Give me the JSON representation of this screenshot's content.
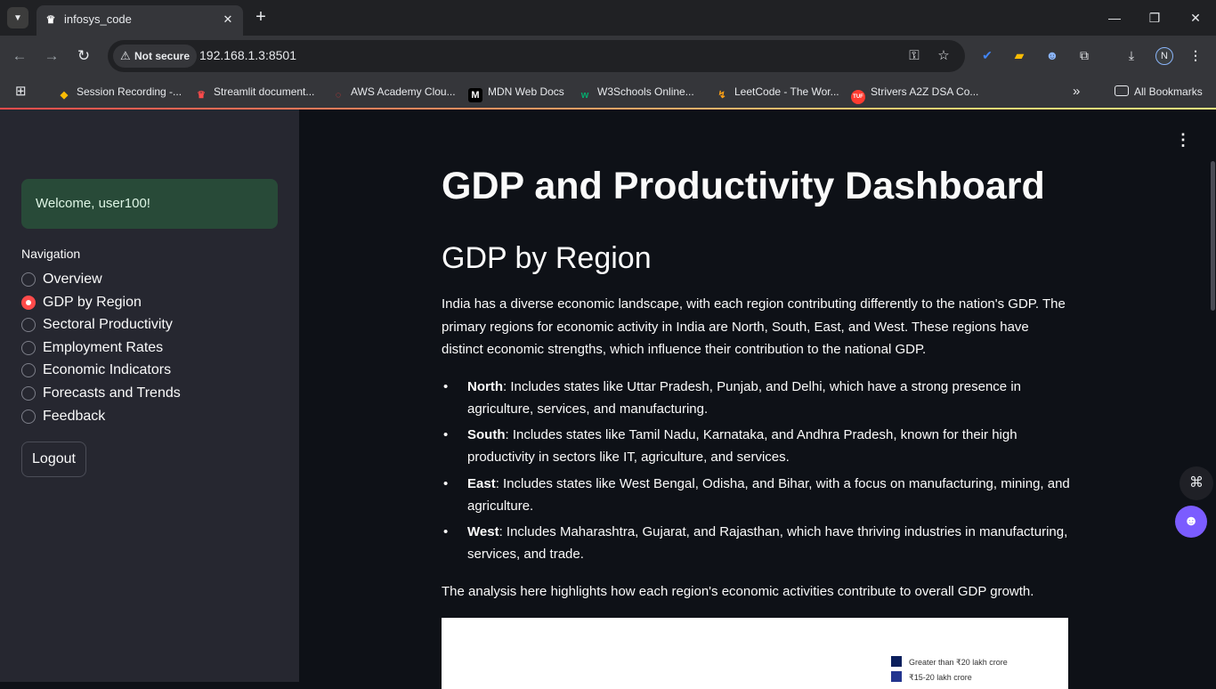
{
  "browser": {
    "tab_title": "infosys_code",
    "tab_favicon": "♛",
    "security_label": "Not secure",
    "url": "192.168.1.3:8501",
    "profile_initial": "N",
    "bookmarks": [
      {
        "label": "Session Recording -...",
        "icon": "◆",
        "color": "#fbbc04"
      },
      {
        "label": "Streamlit document...",
        "icon": "♛",
        "color": "#ff4b4b"
      },
      {
        "label": "AWS Academy Clou...",
        "icon": "◌",
        "color": "#e53935"
      },
      {
        "label": "MDN Web Docs",
        "icon": "M",
        "color": "#ffffff"
      },
      {
        "label": "W3Schools Online...",
        "icon": "w",
        "color": "#04aa6d"
      },
      {
        "label": "LeetCode - The Wor...",
        "icon": "↯",
        "color": "#ffa116"
      },
      {
        "label": "Strivers A2Z DSA Co...",
        "icon": "TUF",
        "color": "#ff3b30"
      }
    ],
    "all_bookmarks": "All Bookmarks"
  },
  "sidebar": {
    "welcome": "Welcome, user100!",
    "nav_label": "Navigation",
    "nav_items": [
      {
        "label": "Overview",
        "selected": false
      },
      {
        "label": "GDP by Region",
        "selected": true
      },
      {
        "label": "Sectoral Productivity",
        "selected": false
      },
      {
        "label": "Employment Rates",
        "selected": false
      },
      {
        "label": "Economic Indicators",
        "selected": false
      },
      {
        "label": "Forecasts and Trends",
        "selected": false
      },
      {
        "label": "Feedback",
        "selected": false
      }
    ],
    "logout": "Logout"
  },
  "main": {
    "title": "GDP and Productivity Dashboard",
    "section_title": "GDP by Region",
    "intro": "India has a diverse economic landscape, with each region contributing differently to the nation's GDP. The primary regions for economic activity in India are North, South, East, and West. These regions have distinct economic strengths, which influence their contribution to the national GDP.",
    "regions": [
      {
        "name": "North",
        "text": ": Includes states like Uttar Pradesh, Punjab, and Delhi, which have a strong presence in agriculture, services, and manufacturing."
      },
      {
        "name": "South",
        "text": ": Includes states like Tamil Nadu, Karnataka, and Andhra Pradesh, known for their high productivity in sectors like IT, agriculture, and services."
      },
      {
        "name": "East",
        "text": ": Includes states like West Bengal, Odisha, and Bihar, with a focus on manufacturing, mining, and agriculture."
      },
      {
        "name": "West",
        "text": ": Includes Maharashtra, Gujarat, and Rajasthan, which have thriving industries in manufacturing, services, and trade."
      }
    ],
    "summary": "The analysis here highlights how each region's economic activities contribute to overall GDP growth.",
    "legend": [
      {
        "label": "Greater than ₹20 lakh crore",
        "color": "#0b1f5c"
      },
      {
        "label": "₹15-20 lakh crore",
        "color": "#23358f"
      }
    ]
  }
}
